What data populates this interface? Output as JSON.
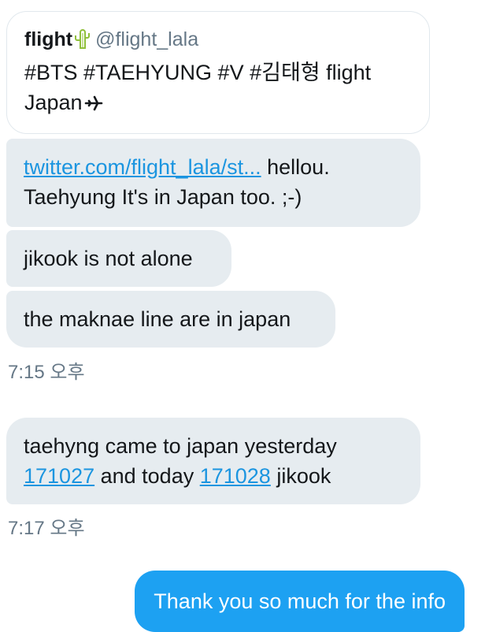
{
  "quote_tweet": {
    "name": "flight",
    "handle": "@flight_lala",
    "text_line1": "#BTS #TAEHYUNG  #V #김태형  flight",
    "text_line2": "Japan"
  },
  "messages": [
    {
      "link": "twitter.com/flight_lala/st...",
      "text_after_link": " hellou.",
      "text_line2": "Taehyung It's in Japan too. ;-)"
    },
    {
      "text": "jikook is not alone"
    },
    {
      "text": "the maknae line are in japan"
    },
    {
      "timestamp": "7:15 오후"
    },
    {
      "text_line1": "taehyng came to japan yesterday",
      "link1": "171027",
      "mid_text": " and today ",
      "link2": "171028",
      "end_text": " jikook"
    },
    {
      "timestamp": "7:17 오후"
    },
    {
      "text": "Thank you so much for the info"
    }
  ],
  "colors": {
    "incoming_bubble": "#e6ecf0",
    "outgoing_bubble": "#1da1f2",
    "link": "#1b95e0",
    "timestamp": "#657786"
  },
  "icons": [
    "cactus-icon",
    "airplane-icon"
  ]
}
